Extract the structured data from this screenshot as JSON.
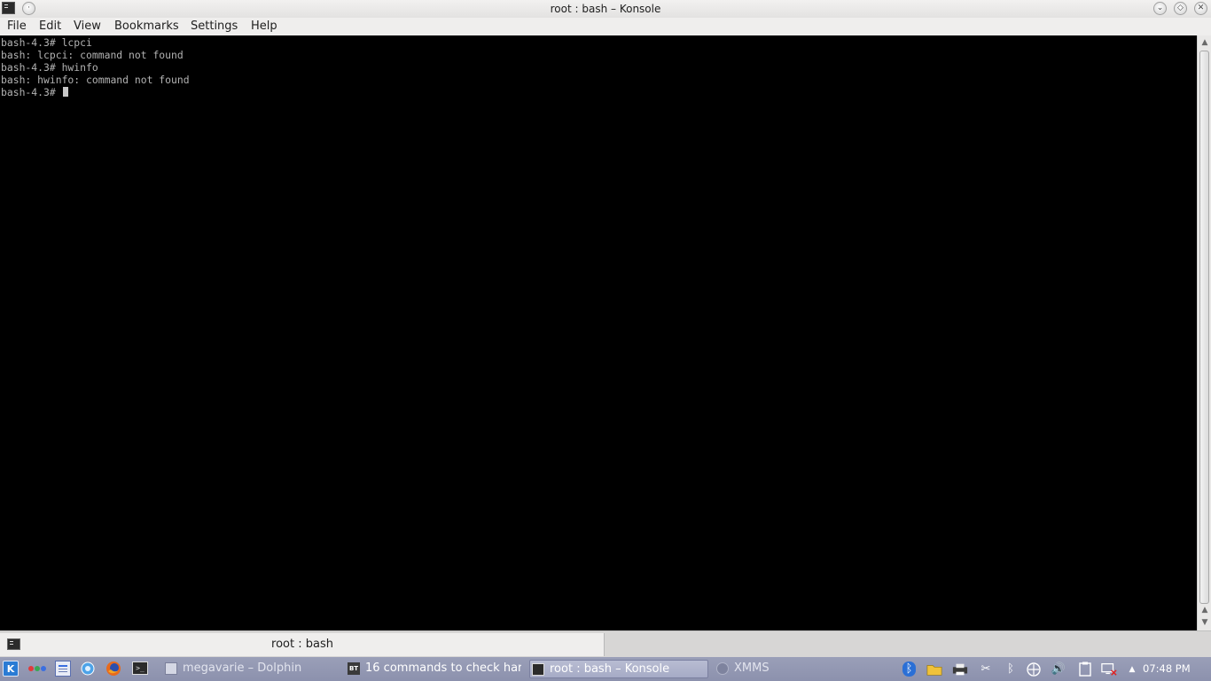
{
  "window": {
    "title": "root : bash – Konsole",
    "menu": [
      "File",
      "Edit",
      "View",
      "Bookmarks",
      "Settings",
      "Help"
    ]
  },
  "terminal": {
    "lines": [
      "bash-4.3# lcpci",
      "bash: lcpci: command not found",
      "bash-4.3# hwinfo",
      "bash: hwinfo: command not found",
      "bash-4.3# "
    ]
  },
  "tabbar": {
    "tab_label": "root : bash"
  },
  "taskbar": {
    "launchers": [
      "kde-menu-icon",
      "activities-icon",
      "dolphin-icon",
      "settings-icon",
      "firefox-icon",
      "konsole-icon"
    ],
    "tasks": [
      {
        "label": "megavarie – Dolphin",
        "icon": "folder-icon",
        "active": false
      },
      {
        "label": "16 commands to check har",
        "icon": "bt-icon",
        "icon_text": "BT",
        "active": false
      },
      {
        "label": "root : bash – Konsole",
        "icon": "terminal-icon",
        "active": true
      },
      {
        "label": "XMMS",
        "icon": "xmms-icon",
        "active": false
      }
    ],
    "tray": [
      "bluetooth-icon",
      "folder-icon",
      "printer-icon",
      "scissors-icon",
      "bluetooth-alt-icon",
      "network-icon",
      "volume-icon",
      "clipboard-icon",
      "display-icon",
      "expand-arrow-icon"
    ],
    "clock": "07:48 PM"
  }
}
